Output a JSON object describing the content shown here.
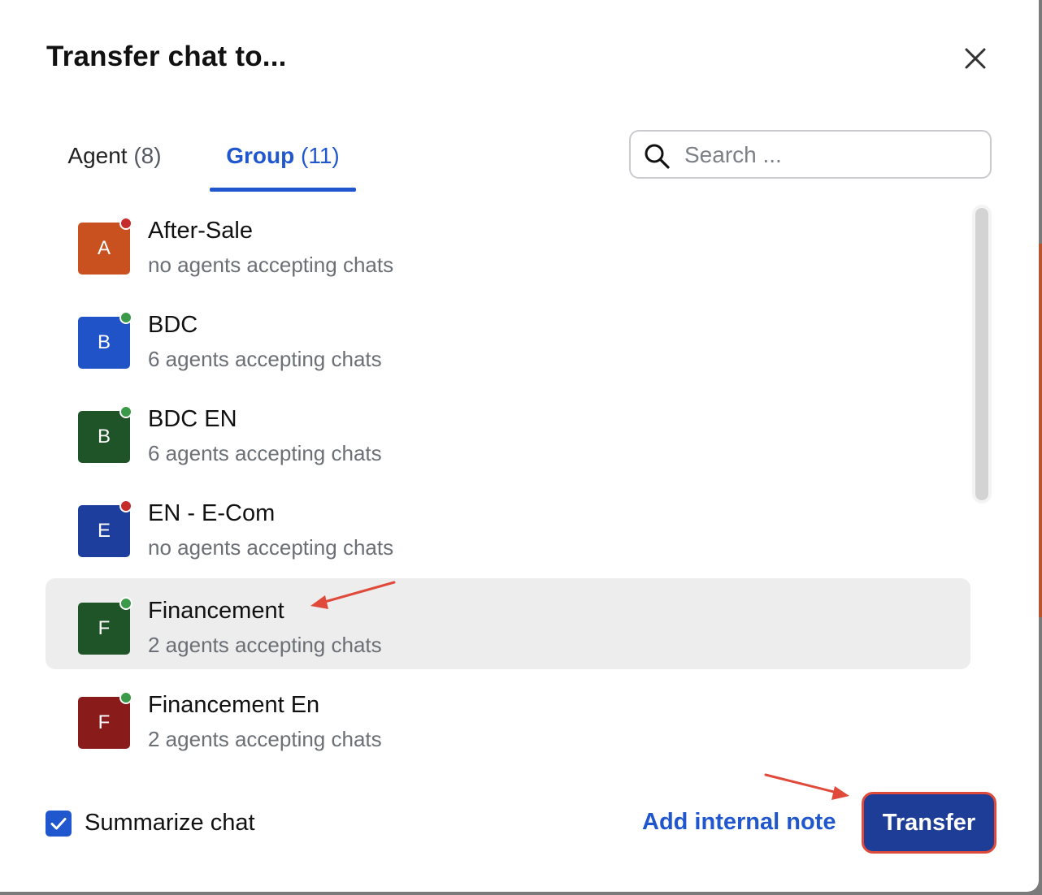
{
  "dialog": {
    "title": "Transfer chat to...",
    "close_icon": "close-icon"
  },
  "tabs": [
    {
      "label": "Agent",
      "count": "(8)",
      "active": false
    },
    {
      "label": "Group",
      "count": "(11)",
      "active": true
    }
  ],
  "search": {
    "placeholder": "Search ...",
    "value": "",
    "icon": "search-icon"
  },
  "groups": [
    {
      "initial": "A",
      "name": "After-Sale",
      "status_text": "no agents accepting chats",
      "status": "offline",
      "avatar_color": "#c8511f",
      "selected": false
    },
    {
      "initial": "B",
      "name": "BDC",
      "status_text": "6 agents accepting chats",
      "status": "online",
      "avatar_color": "#2052c8",
      "selected": false
    },
    {
      "initial": "B",
      "name": "BDC EN",
      "status_text": "6 agents accepting chats",
      "status": "online",
      "avatar_color": "#1f5428",
      "selected": false
    },
    {
      "initial": "E",
      "name": "EN - E-Com",
      "status_text": "no agents accepting chats",
      "status": "offline",
      "avatar_color": "#1d3e9c",
      "selected": false
    },
    {
      "initial": "F",
      "name": "Financement",
      "status_text": "2 agents accepting chats",
      "status": "online",
      "avatar_color": "#1f5428",
      "selected": true
    },
    {
      "initial": "F",
      "name": "Financement En",
      "status_text": "2 agents accepting chats",
      "status": "online",
      "avatar_color": "#8a1b1b",
      "selected": false
    }
  ],
  "status_colors": {
    "online": "#3a9a4a",
    "offline": "#c62c2c"
  },
  "footer": {
    "summarize_label": "Summarize chat",
    "summarize_checked": true,
    "add_note_label": "Add internal note",
    "transfer_label": "Transfer"
  },
  "colors": {
    "accent": "#2057cf",
    "primary_button": "#1d3d96",
    "annotation_arrow": "#e04a3a"
  }
}
